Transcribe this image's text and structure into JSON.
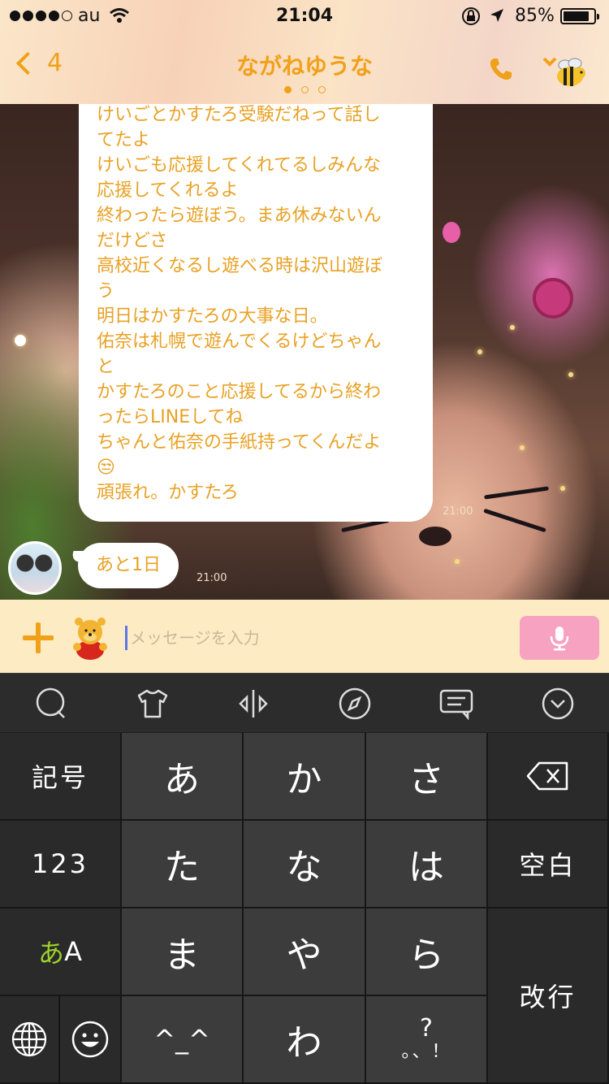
{
  "status_bar": {
    "carrier": "au",
    "time": "21:04",
    "battery_percent": "85%",
    "battery_level": 0.85,
    "signal_bars_filled": 4,
    "signal_bars_total": 5
  },
  "header": {
    "back_count": "4",
    "title": "ながねゆうな",
    "page_dots": 3,
    "active_page": 0,
    "accent_color": "#f0a11a"
  },
  "messages": {
    "outgoing": {
      "lines": [
        "けいごとかすたろ受験だねって話し",
        "てたよ",
        "けいごも応援してくれてるしみんな",
        "応援してくれるよ",
        "終わったら遊ぼう。まあ休みないん",
        "だけどさ",
        "高校近くなるし遊べる時は沢山遊ぼ",
        "う",
        "明日はかすたろの大事な日。",
        "佑奈は札幌で遊んでくるけどちゃん",
        "と",
        "かすたろのこと応援してるから終わ",
        "ったらLINEしてね",
        "ちゃんと佑奈の手紙持ってくんだよ",
        "😒",
        "頑張れ。かすたろ"
      ],
      "time": "21:00"
    },
    "incoming": {
      "text": "あと1日",
      "time": "21:00"
    }
  },
  "input": {
    "placeholder": "メッセージを入力",
    "value": ""
  },
  "keyboard": {
    "toolbar_icons": [
      "chat-bubble-icon",
      "shirt-icon",
      "cursor-move-icon",
      "compass-icon",
      "message-icon",
      "collapse-icon"
    ],
    "keys": {
      "symbols": "記号",
      "numbers": "123",
      "kana_a_green": "あ",
      "kana_a_latin": "A",
      "a": "あ",
      "ka": "か",
      "sa": "さ",
      "ta": "た",
      "na": "な",
      "ha": "は",
      "ma": "ま",
      "ya": "や",
      "ra": "ら",
      "face": "^_^",
      "wa": "わ",
      "punct_top": "?",
      "punct_bottom": "。、！",
      "space": "空白",
      "return": "改行"
    }
  }
}
